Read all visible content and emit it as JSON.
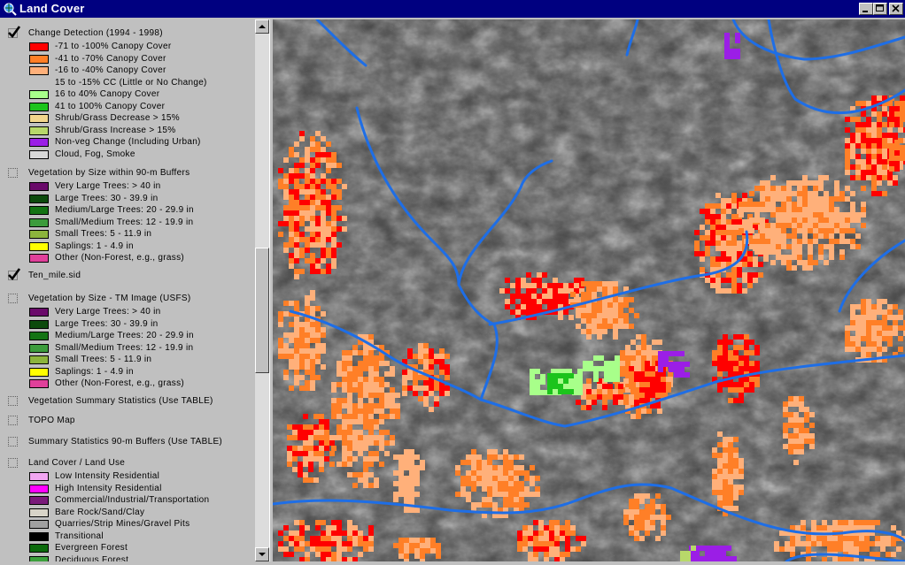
{
  "window": {
    "title": "Land Cover"
  },
  "toc": {
    "layers": [
      {
        "name": "Change Detection (1994 - 1998)",
        "checked": true,
        "legend": [
          {
            "label": "-71 to -100% Canopy Cover",
            "color": "#ff0000"
          },
          {
            "label": "-41 to -70% Canopy Cover",
            "color": "#ff7f27"
          },
          {
            "label": "-16 to -40% Canopy Cover",
            "color": "#ffb07a"
          },
          {
            "label": "15 to -15% CC (Little or No Change)",
            "color": null
          },
          {
            "label": "16 to 40% Canopy Cover",
            "color": "#a8ff8a"
          },
          {
            "label": "41 to 100% Canopy Cover",
            "color": "#1cc41c"
          },
          {
            "label": "Shrub/Grass Decrease > 15%",
            "color": "#f2d68c"
          },
          {
            "label": "Shrub/Grass Increase > 15%",
            "color": "#b8d86a"
          },
          {
            "label": "Non-veg Change (Including Urban)",
            "color": "#9b1ee6"
          },
          {
            "label": "Cloud, Fog, Smoke",
            "color": "#d8d8d8"
          }
        ]
      },
      {
        "name": "Vegetation by Size within 90-m Buffers",
        "checked": false,
        "legend": [
          {
            "label": "Very Large Trees: > 40  in",
            "color": "#6a0a6a"
          },
          {
            "label": "Large Trees: 30 - 39.9 in",
            "color": "#0c4a0c"
          },
          {
            "label": "Medium/Large Trees: 20 - 29.9 in",
            "color": "#137313"
          },
          {
            "label": "Small/Medium Trees: 12 - 19.9 in",
            "color": "#3c9c3c"
          },
          {
            "label": "Small Trees: 5 - 11.9 in",
            "color": "#8cb43c"
          },
          {
            "label": "Saplings: 1 - 4.9 in",
            "color": "#ffff00"
          },
          {
            "label": "Other (Non-Forest, e.g., grass)",
            "color": "#e0409a"
          }
        ]
      },
      {
        "name": "Ten_mile.sid",
        "checked": true,
        "legend": []
      },
      {
        "name": "Vegetation by Size - TM Image (USFS)",
        "checked": false,
        "legend": [
          {
            "label": "Very Large Trees: > 40  in",
            "color": "#6a0a6a"
          },
          {
            "label": "Large Trees: 30 - 39.9 in",
            "color": "#0c4a0c"
          },
          {
            "label": "Medium/Large Trees: 20 - 29.9 in",
            "color": "#137313"
          },
          {
            "label": "Small/Medium Trees: 12 - 19.9 in",
            "color": "#3c9c3c"
          },
          {
            "label": "Small Trees: 5 - 11.9 in",
            "color": "#8cb43c"
          },
          {
            "label": "Saplings: 1 - 4.9 in",
            "color": "#ffff00"
          },
          {
            "label": "Other (Non-Forest, e.g., grass)",
            "color": "#e0409a"
          }
        ]
      },
      {
        "name": "Vegetation Summary Statistics (Use TABLE)",
        "checked": false,
        "legend": []
      },
      {
        "name": "TOPO Map",
        "checked": false,
        "legend": []
      },
      {
        "name": "Summary Statistics 90-m Buffers (Use TABLE)",
        "checked": false,
        "legend": []
      },
      {
        "name": "Land Cover / Land Use",
        "checked": false,
        "legend": [
          {
            "label": "Low Intensity Residential",
            "color": "#f2a6f2"
          },
          {
            "label": "High Intensity Residential",
            "color": "#ff00ff"
          },
          {
            "label": "Commercial/Industrial/Transportation",
            "color": "#7a1a7a"
          },
          {
            "label": "Bare Rock/Sand/Clay",
            "color": "#d8d4c8"
          },
          {
            "label": "Quarries/Strip Mines/Gravel Pits",
            "color": "#a0a0a0"
          },
          {
            "label": "Transitional",
            "color": "#000000"
          },
          {
            "label": "Evergreen Forest",
            "color": "#0c6a0c"
          },
          {
            "label": "Deciduous Forest",
            "color": "#3ca03c"
          }
        ]
      }
    ]
  },
  "map": {
    "rivers_color": "#1e6ee6",
    "patch_colors": {
      "loss_high": "#ff0000",
      "loss_mid": "#ff7f27",
      "loss_low": "#ffb07a",
      "gain_low": "#a8ff8a",
      "gain_high": "#1cc41c",
      "nonveg": "#9b1ee6",
      "shrub_increase": "#b8d86a"
    }
  }
}
